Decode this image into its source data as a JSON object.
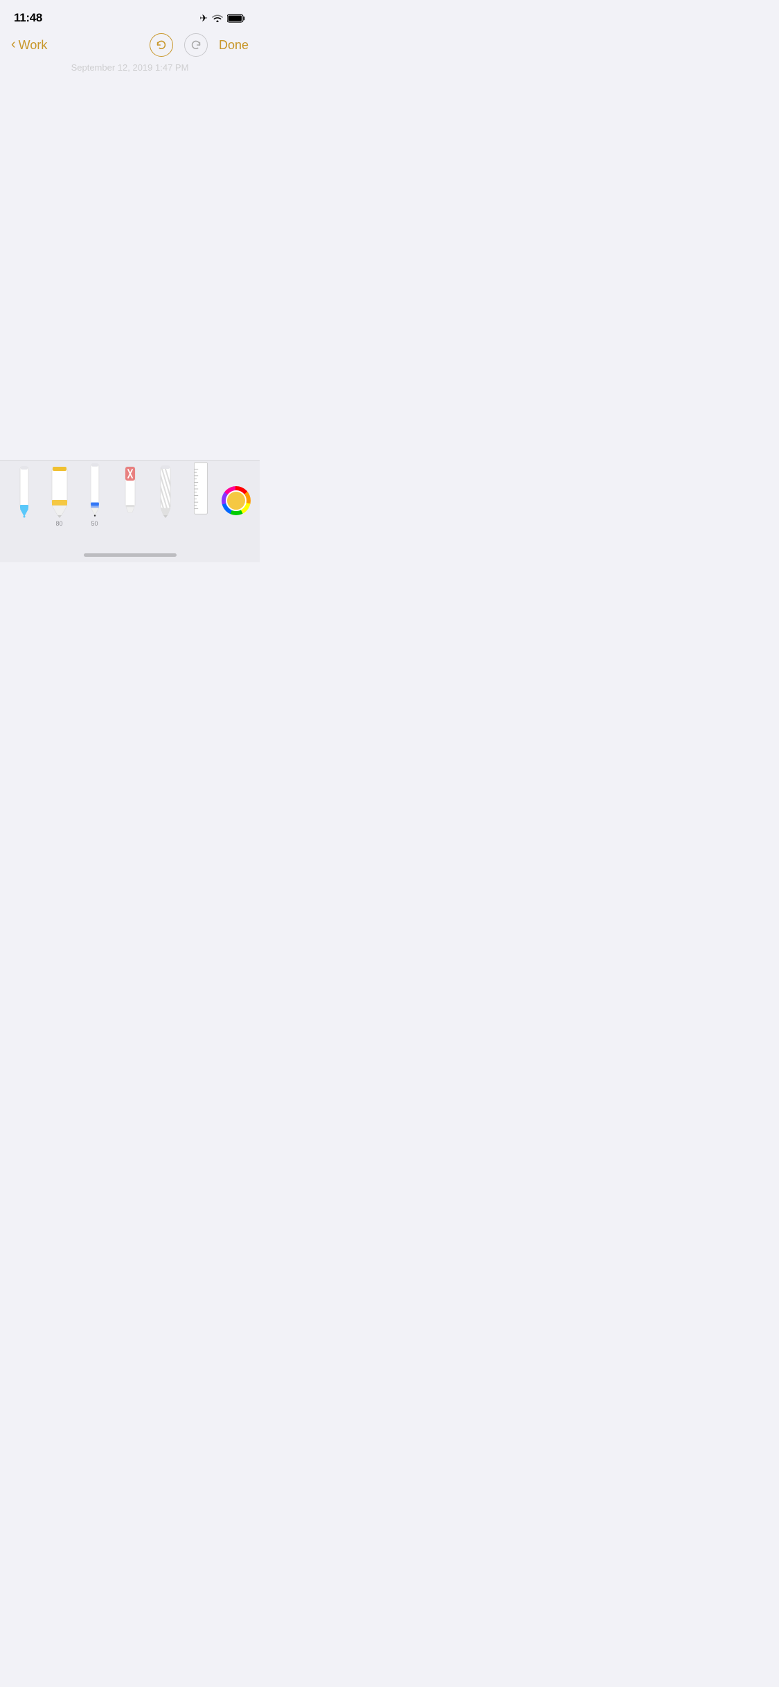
{
  "status_bar": {
    "time": "11:48",
    "airplane_mode": true,
    "wifi": true,
    "battery": "full"
  },
  "nav": {
    "back_label": "Work",
    "done_label": "Done",
    "undo_aria": "Undo",
    "redo_aria": "Redo"
  },
  "date_watermark": "September 12, 2019 1:47 PM",
  "toolbar": {
    "tools": [
      {
        "id": "pen",
        "label": "",
        "color": "#5ac8fa"
      },
      {
        "id": "marker",
        "label": "80",
        "color": "#f5c842"
      },
      {
        "id": "pencil",
        "label": "50",
        "color": "#3478f6"
      },
      {
        "id": "eraser",
        "label": "",
        "color": "#e88080"
      },
      {
        "id": "lasso",
        "label": "",
        "color": "#aaaaaa"
      },
      {
        "id": "ruler",
        "label": "",
        "color": "#dddddd"
      }
    ],
    "color_picker_aria": "Color Picker"
  },
  "accent_color": "#c8972a",
  "home_indicator": true
}
